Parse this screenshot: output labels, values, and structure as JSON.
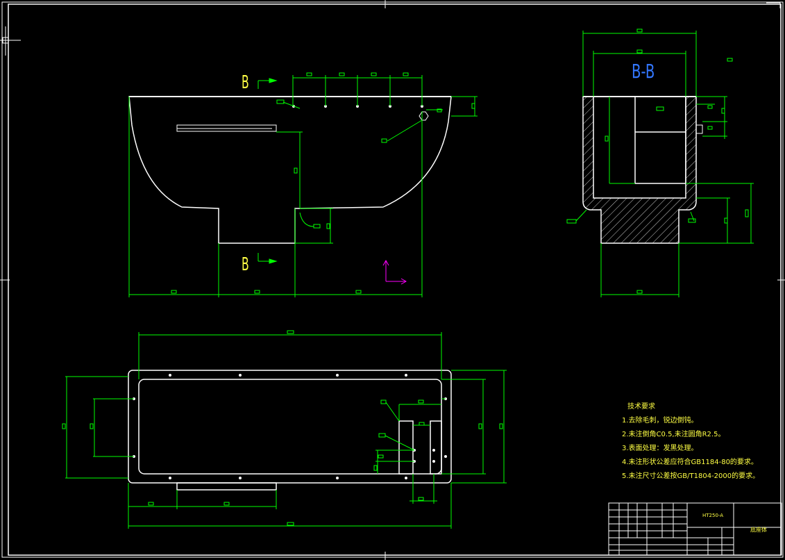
{
  "section_labels": {
    "top_arrow_letter": "B",
    "bottom_arrow_letter": "B",
    "section_title": "B-B"
  },
  "technical_requirements": {
    "title": "技术要求",
    "items": [
      "1.去除毛刺，锐边倒钝。",
      "2.未注倒角C0.5,未注圆角R2.5。",
      "3.表面处理：发黑处理。",
      "4.未注形状公差应符合GB1184-80的要求。",
      "5.未注尺寸公差按GB/T1804-2000的要求。"
    ]
  },
  "title_block": {
    "material": "HT250-A",
    "part_name": "底座体"
  },
  "colors": {
    "background": "#000000",
    "outline": "#ffffff",
    "dimension": "#00ff00",
    "text": "#ffff44",
    "section_title": "#3377ff",
    "axis": "#ff00ff"
  }
}
